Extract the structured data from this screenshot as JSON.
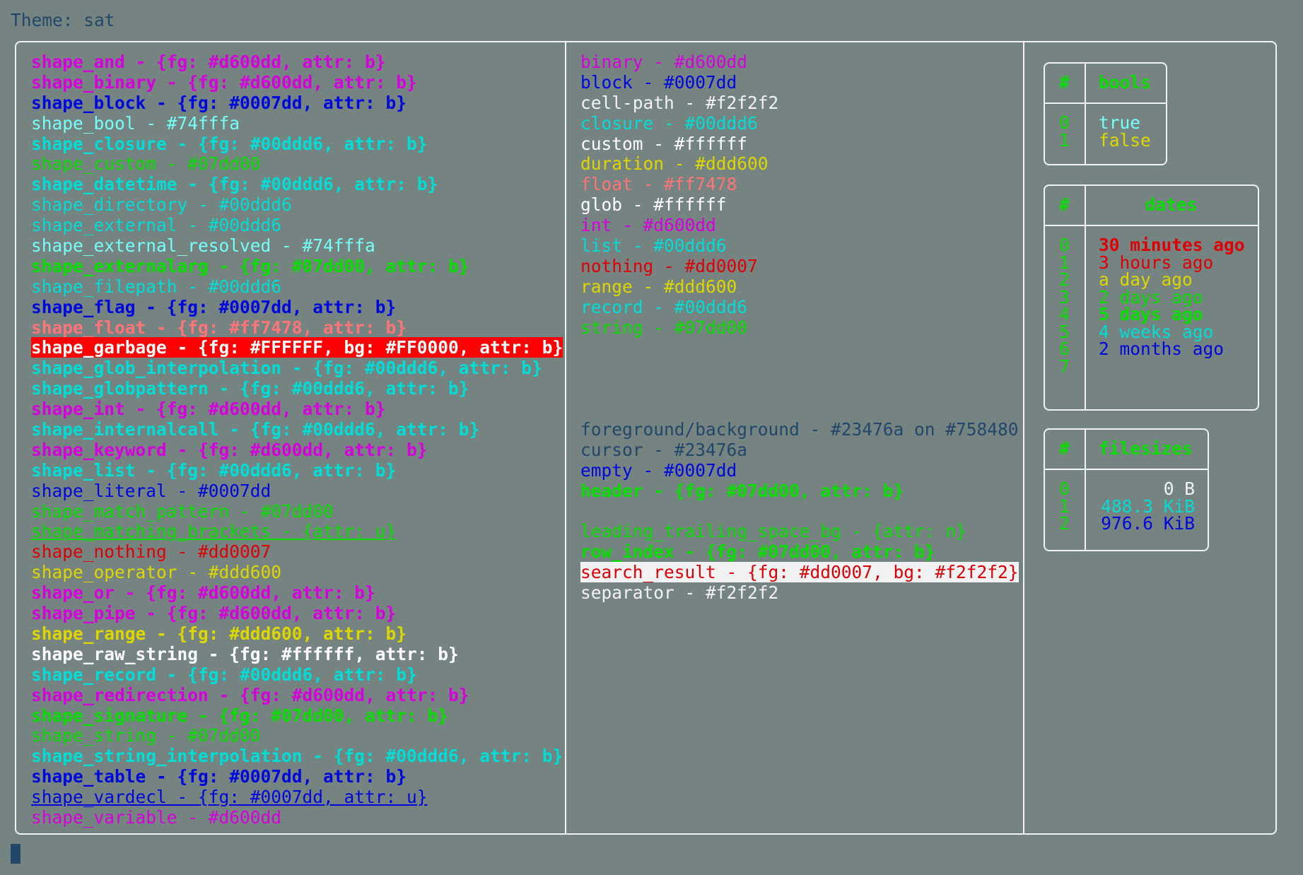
{
  "header": {
    "title": "Theme: sat"
  },
  "left_column": [
    {
      "text": "shape_and - {fg: #d600dd, attr: b}",
      "fg": "#d600dd",
      "bold": true
    },
    {
      "text": "shape_binary - {fg: #d600dd, attr: b}",
      "fg": "#d600dd",
      "bold": true
    },
    {
      "text": "shape_block - {fg: #0007dd, attr: b}",
      "fg": "#0007dd",
      "bold": true
    },
    {
      "text": "shape_bool - #74fffa",
      "fg": "#74fffa"
    },
    {
      "text": "shape_closure - {fg: #00ddd6, attr: b}",
      "fg": "#00ddd6",
      "bold": true
    },
    {
      "text": "shape_custom - #07dd00",
      "fg": "#07dd00"
    },
    {
      "text": "shape_datetime - {fg: #00ddd6, attr: b}",
      "fg": "#00ddd6",
      "bold": true
    },
    {
      "text": "shape_directory - #00ddd6",
      "fg": "#00ddd6"
    },
    {
      "text": "shape_external - #00ddd6",
      "fg": "#00ddd6"
    },
    {
      "text": "shape_external_resolved - #74fffa",
      "fg": "#74fffa"
    },
    {
      "text": "shape_externalarg - {fg: #07dd00, attr: b}",
      "fg": "#07dd00",
      "bold": true
    },
    {
      "text": "shape_filepath - #00ddd6",
      "fg": "#00ddd6"
    },
    {
      "text": "shape_flag - {fg: #0007dd, attr: b}",
      "fg": "#0007dd",
      "bold": true
    },
    {
      "text": "shape_float - {fg: #ff7478, attr: b}",
      "fg": "#ff7478",
      "bold": true
    },
    {
      "text": "shape_garbage - {fg: #FFFFFF, bg: #FF0000, attr: b}",
      "fg": "#FFFFFF",
      "bg": "#FF0000",
      "bold": true
    },
    {
      "text": "shape_glob_interpolation - {fg: #00ddd6, attr: b}",
      "fg": "#00ddd6",
      "bold": true
    },
    {
      "text": "shape_globpattern - {fg: #00ddd6, attr: b}",
      "fg": "#00ddd6",
      "bold": true
    },
    {
      "text": "shape_int - {fg: #d600dd, attr: b}",
      "fg": "#d600dd",
      "bold": true
    },
    {
      "text": "shape_internalcall - {fg: #00ddd6, attr: b}",
      "fg": "#00ddd6",
      "bold": true
    },
    {
      "text": "shape_keyword - {fg: #d600dd, attr: b}",
      "fg": "#d600dd",
      "bold": true
    },
    {
      "text": "shape_list - {fg: #00ddd6, attr: b}",
      "fg": "#00ddd6",
      "bold": true
    },
    {
      "text": "shape_literal - #0007dd",
      "fg": "#0007dd"
    },
    {
      "text": "shape_match_pattern - #07dd00",
      "fg": "#07dd00"
    },
    {
      "text": "shape_matching_brackets - {attr: u}",
      "fg": "#07dd00",
      "underline": true
    },
    {
      "text": "shape_nothing - #dd0007",
      "fg": "#dd0007"
    },
    {
      "text": "shape_operator - #ddd600",
      "fg": "#ddd600"
    },
    {
      "text": "shape_or - {fg: #d600dd, attr: b}",
      "fg": "#d600dd",
      "bold": true
    },
    {
      "text": "shape_pipe - {fg: #d600dd, attr: b}",
      "fg": "#d600dd",
      "bold": true
    },
    {
      "text": "shape_range - {fg: #ddd600, attr: b}",
      "fg": "#ddd600",
      "bold": true
    },
    {
      "text": "shape_raw_string - {fg: #ffffff, attr: b}",
      "fg": "#ffffff",
      "bold": true
    },
    {
      "text": "shape_record - {fg: #00ddd6, attr: b}",
      "fg": "#00ddd6",
      "bold": true
    },
    {
      "text": "shape_redirection - {fg: #d600dd, attr: b}",
      "fg": "#d600dd",
      "bold": true
    },
    {
      "text": "shape_signature - {fg: #07dd00, attr: b}",
      "fg": "#07dd00",
      "bold": true
    },
    {
      "text": "shape_string - #07dd00",
      "fg": "#07dd00"
    },
    {
      "text": "shape_string_interpolation - {fg: #00ddd6, attr: b}",
      "fg": "#00ddd6",
      "bold": true
    },
    {
      "text": "shape_table - {fg: #0007dd, attr: b}",
      "fg": "#0007dd",
      "bold": true
    },
    {
      "text": "shape_vardecl - {fg: #0007dd, attr: u}",
      "fg": "#0007dd",
      "underline": true
    },
    {
      "text": "shape_variable - #d600dd",
      "fg": "#d600dd"
    }
  ],
  "middle_column": [
    {
      "text": "binary - #d600dd",
      "fg": "#d600dd"
    },
    {
      "text": "block - #0007dd",
      "fg": "#0007dd"
    },
    {
      "text": "cell-path - #f2f2f2",
      "fg": "#f2f2f2"
    },
    {
      "text": "closure - #00ddd6",
      "fg": "#00ddd6"
    },
    {
      "text": "custom - #ffffff",
      "fg": "#ffffff"
    },
    {
      "text": "duration - #ddd600",
      "fg": "#ddd600"
    },
    {
      "text": "float - #ff7478",
      "fg": "#ff7478"
    },
    {
      "text": "glob - #ffffff",
      "fg": "#ffffff"
    },
    {
      "text": "int - #d600dd",
      "fg": "#d600dd"
    },
    {
      "text": "list - #00ddd6",
      "fg": "#00ddd6"
    },
    {
      "text": "nothing - #dd0007",
      "fg": "#dd0007"
    },
    {
      "text": "range - #ddd600",
      "fg": "#ddd600"
    },
    {
      "text": "record - #00ddd6",
      "fg": "#00ddd6"
    },
    {
      "text": "string - #07dd00",
      "fg": "#07dd00"
    },
    {
      "text": "",
      "fg": ""
    },
    {
      "text": "",
      "fg": ""
    },
    {
      "text": "",
      "fg": ""
    },
    {
      "text": "",
      "fg": ""
    },
    {
      "text": "foreground/background - #23476a on #758480",
      "fg": "#23476a"
    },
    {
      "text": "cursor - #23476a",
      "fg": "#23476a"
    },
    {
      "text": "empty - #0007dd",
      "fg": "#0007dd"
    },
    {
      "text": "header - {fg: #07dd00, attr: b}",
      "fg": "#07dd00",
      "bold": true
    },
    {
      "text": "",
      "fg": ""
    },
    {
      "text": "leading_trailing_space_bg - {attr: n}",
      "fg": "#07dd00"
    },
    {
      "text": "row_index - {fg: #07dd00, attr: b}",
      "fg": "#07dd00",
      "bold": true
    },
    {
      "text": "search_result - {fg: #dd0007, bg: #f2f2f2}",
      "fg": "#dd0007",
      "bg": "#f2f2f2"
    },
    {
      "text": "separator - #f2f2f2",
      "fg": "#f2f2f2"
    }
  ],
  "tables": {
    "bools": {
      "index_header": "#",
      "col_header": "bools",
      "rows": [
        {
          "idx": "0",
          "val": "true",
          "fg": "#74fffa"
        },
        {
          "idx": "1",
          "val": "false",
          "fg": "#ddd600"
        }
      ]
    },
    "dates": {
      "index_header": "#",
      "col_header": "dates",
      "rows": [
        {
          "idx": "0",
          "val": "30 minutes ago",
          "fg": "#dd0007",
          "bold": true
        },
        {
          "idx": "1",
          "val": "3 hours ago",
          "fg": "#dd0007"
        },
        {
          "idx": "2",
          "val": "a day ago",
          "fg": "#ddd600"
        },
        {
          "idx": "3",
          "val": "2 days ago",
          "fg": "#07dd00"
        },
        {
          "idx": "4",
          "val": "5 days ago",
          "fg": "#07dd00",
          "bold": true
        },
        {
          "idx": "5",
          "val": "4 weeks ago",
          "fg": "#00ddd6"
        },
        {
          "idx": "6",
          "val": "2 months ago",
          "fg": "#0007dd"
        },
        {
          "idx": "7",
          "val": "",
          "fg": "#0007dd"
        }
      ]
    },
    "filesizes": {
      "index_header": "#",
      "col_header": "filesizes",
      "rows": [
        {
          "idx": "0",
          "val": "0 B",
          "fg": "#f2f2f2"
        },
        {
          "idx": "1",
          "val": "488.3 KiB",
          "fg": "#00ddd6"
        },
        {
          "idx": "2",
          "val": "976.6 KiB",
          "fg": "#0007dd"
        }
      ]
    }
  }
}
